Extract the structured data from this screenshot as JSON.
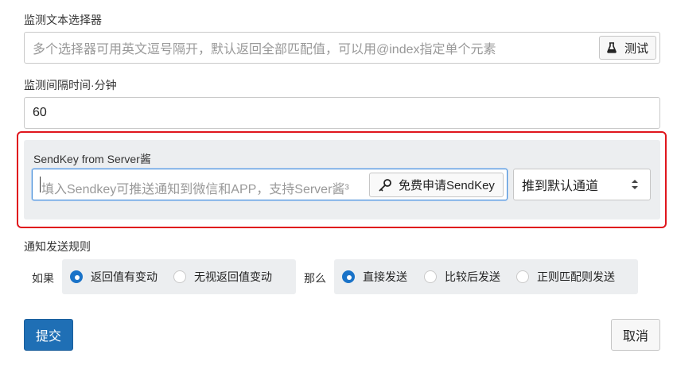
{
  "selector": {
    "label": "监测文本选择器",
    "placeholder": "多个选择器可用英文逗号隔开，默认返回全部匹配值，可以用@index指定单个元素",
    "test_button": "测试",
    "test_icon": "flask-icon"
  },
  "interval": {
    "label": "监测间隔时间·分钟",
    "value": "60"
  },
  "sendkey": {
    "label": "SendKey from Server酱",
    "placeholder": "填入Sendkey可推送通知到微信和APP，支持Server酱³",
    "apply_button": "免费申请SendKey",
    "apply_icon": "key-icon",
    "channel_selected": "推到默认通道",
    "outline_color": "#e0161d"
  },
  "rules": {
    "label": "通知发送规则",
    "if_label": "如果",
    "then_label": "那么",
    "if_options": [
      {
        "label": "返回值有变动",
        "checked": true
      },
      {
        "label": "无视返回值变动",
        "checked": false
      }
    ],
    "then_options": [
      {
        "label": "直接发送",
        "checked": true
      },
      {
        "label": "比较后发送",
        "checked": false
      },
      {
        "label": "正则匹配则发送",
        "checked": false
      }
    ]
  },
  "actions": {
    "submit": "提交",
    "cancel": "取消",
    "primary_color": "#1f6fb5"
  }
}
